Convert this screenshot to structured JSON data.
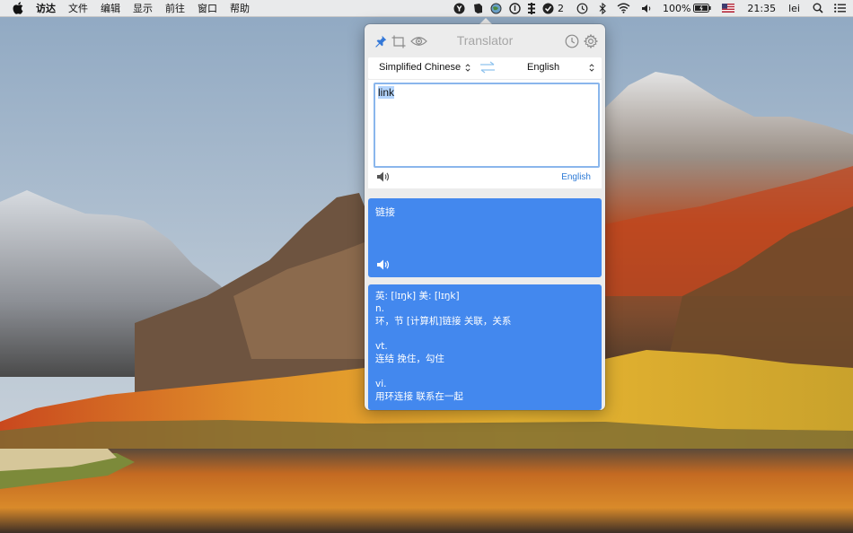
{
  "menubar": {
    "app_menus": [
      "访达",
      "文件",
      "编辑",
      "显示",
      "前往",
      "窗口",
      "帮助"
    ],
    "status": {
      "notification_count": "2",
      "battery": "100%",
      "clock": "21:35",
      "user": "lei"
    }
  },
  "translator": {
    "title": "Translator",
    "source_language": "Simplified Chinese",
    "target_language": "English",
    "input_text": "link",
    "detected_language": "English",
    "translation": "链接",
    "dictionary": {
      "lines": [
        "英: [lɪŋk]  美: [lɪŋk]",
        "n.",
        "环，节 [计算机]链接  关联，关系",
        "",
        "vt.",
        "连结  挽住，勾住",
        "",
        "vi.",
        "用环连接  联系在一起"
      ]
    }
  },
  "colors": {
    "accent_blue": "#4388ee",
    "link_blue": "#2d7ad6",
    "menubar_bg": "#e9eaeb",
    "popover_bg": "#ececec"
  },
  "icons": [
    "apple-icon",
    "pin-icon",
    "crop-icon",
    "eye-icon",
    "history-icon",
    "gear-icon",
    "swap-icon",
    "speaker-icon",
    "wifi-icon",
    "bluetooth-icon",
    "volume-icon",
    "battery-icon",
    "flag-icon",
    "search-icon",
    "menu-list-icon"
  ]
}
